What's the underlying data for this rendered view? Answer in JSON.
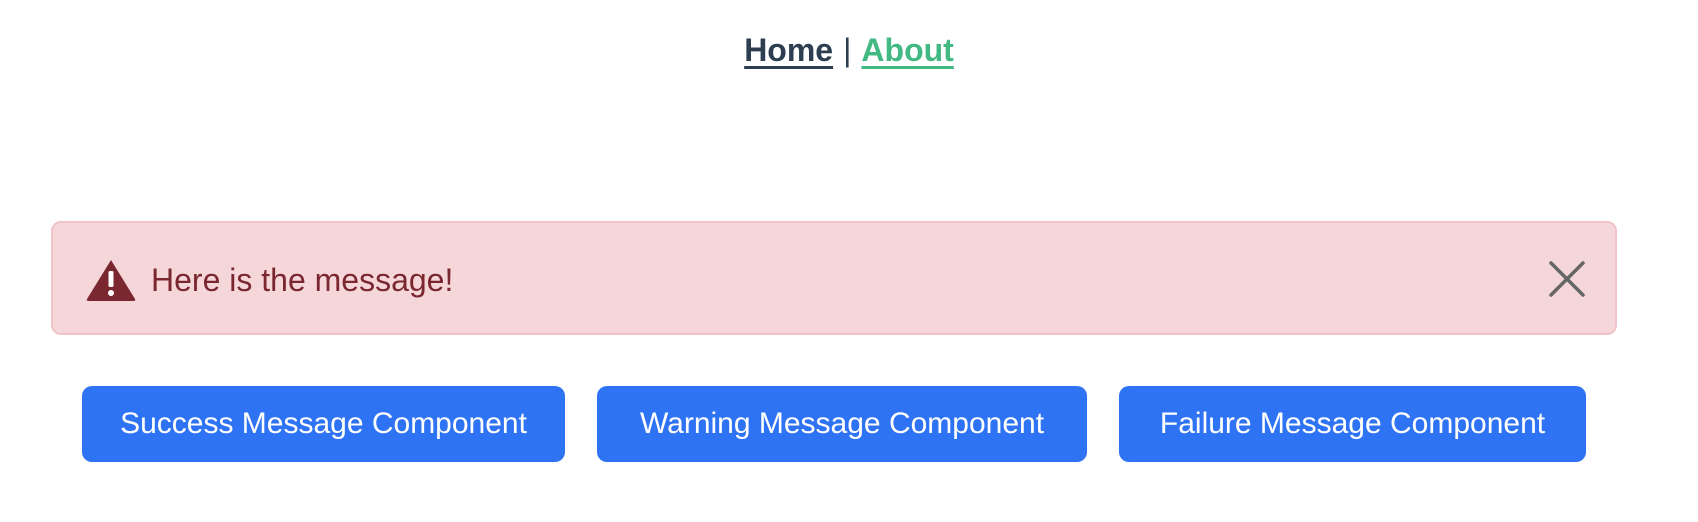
{
  "nav": {
    "home_label": "Home",
    "separator": "|",
    "about_label": "About"
  },
  "alert": {
    "type": "failure",
    "icon": "warning-triangle-icon",
    "message": "Here is the message!",
    "close_icon": "close-icon"
  },
  "buttons": {
    "success_label": "Success Message Component",
    "warning_label": "Warning Message Component",
    "failure_label": "Failure Message Component"
  },
  "colors": {
    "nav_home": "#2c3e50",
    "nav_about": "#42b983",
    "alert_background": "#f5d7da",
    "alert_border": "#f0c3c8",
    "alert_text": "#7a2730",
    "alert_icon": "#7a2730",
    "close_icon": "#666666",
    "button_background": "#2f73f5",
    "button_text": "#ffffff"
  }
}
